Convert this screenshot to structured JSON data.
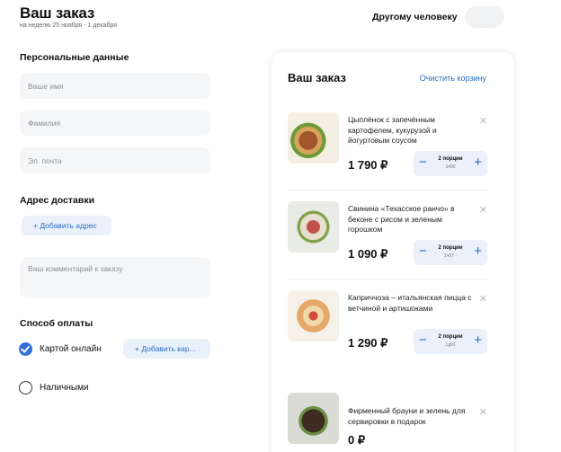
{
  "page": {
    "title": "Ваш заказ",
    "subtitle": "на неделю 25 ноября - 1 декабря",
    "other_person_label": "Другому человеку"
  },
  "personal": {
    "heading": "Персональные данные",
    "name_placeholder": "Ваше имя",
    "surname_placeholder": "Фамилия",
    "email_placeholder": "Эл. почта"
  },
  "delivery": {
    "heading": "Адрес доставки",
    "add_address": "+ Добавить адрес",
    "comment_placeholder": "Ваш комментарий к заказу"
  },
  "payment": {
    "heading": "Способ оплаты",
    "card_online": "Картой онлайн",
    "add_card": "+ Добавить кар...",
    "cash": "Наличными",
    "selected": "card_online"
  },
  "cart": {
    "title": "Ваш заказ",
    "clear_label": "Очистить корзину",
    "items": [
      {
        "name": "Цыплёнок с запечённым картофелем, кукурузой и йогуртовым соусом",
        "price": "1 790 ₽",
        "qty": "2 порции",
        "weight": "1490",
        "icon": "dish-photo"
      },
      {
        "name": "Свинина «Техасское ранчо» в беконе с рисом и зеленым горошком",
        "price": "1 090 ₽",
        "qty": "2 порции",
        "weight": "1ч07 -",
        "icon": "dish-photo"
      },
      {
        "name": "Каприччоза – итальянская пицца с ветчиной и артишоками",
        "price": "1 290 ₽",
        "qty": "2 порции",
        "weight": "1д91",
        "icon": "dish-photo"
      },
      {
        "name": "Фирменный брауни и зелень для сервировки в подарок",
        "price": "0 ₽",
        "icon": "dish-photo"
      }
    ]
  },
  "colors": {
    "accent": "#2a6cc0",
    "radio_selected": "#2f6fd6",
    "chip_bg": "#eaf1fb",
    "field_bg": "#f5f6f8"
  }
}
